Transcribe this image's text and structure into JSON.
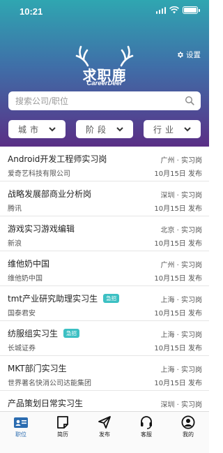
{
  "status": {
    "time": "10:21"
  },
  "logo": {
    "name_cn": "求职鹿",
    "name_en": "CareerDeer"
  },
  "settings": {
    "label": "设置"
  },
  "search": {
    "placeholder": "搜索公司/职位"
  },
  "filters": [
    {
      "label": "城市"
    },
    {
      "label": "阶段"
    },
    {
      "label": "行业"
    }
  ],
  "jobs": [
    {
      "title": "Android开发工程师实习岗",
      "location": "广州 · 实习岗",
      "company": "爱奇艺科技有限公司",
      "date": "10月15日 发布",
      "urgent": ""
    },
    {
      "title": "战略发展部商业分析岗",
      "location": "深圳 · 实习岗",
      "company": "腾讯",
      "date": "10月15日 发布",
      "urgent": ""
    },
    {
      "title": "游戏实习游戏编辑",
      "location": "北京 · 实习岗",
      "company": "新浪",
      "date": "10月15日 发布",
      "urgent": ""
    },
    {
      "title": "维他奶中国",
      "location": "广州 · 实习岗",
      "company": "维他奶中国",
      "date": "10月15日 发布",
      "urgent": ""
    },
    {
      "title": "tmt产业研究助理实习生",
      "location": "上海 · 实习岗",
      "company": "国泰君安",
      "date": "10月15日 发布",
      "urgent": "急招"
    },
    {
      "title": "纺服组实习生",
      "location": "上海 · 实习岗",
      "company": "长城证券",
      "date": "10月15日 发布",
      "urgent": "急招"
    },
    {
      "title": "MKT部门实习生",
      "location": "上海 · 实习岗",
      "company": "世界著名快消公司达能集团",
      "date": "10月15日 发布",
      "urgent": ""
    },
    {
      "title": "产品策划日常实习生",
      "location": "深圳 · 实习岗",
      "company": "",
      "date": "",
      "urgent": ""
    }
  ],
  "tabbar": [
    {
      "label": "职位",
      "icon": "job-card-icon",
      "active": true
    },
    {
      "label": "简历",
      "icon": "resume-icon",
      "active": false
    },
    {
      "label": "发布",
      "icon": "send-icon",
      "active": false
    },
    {
      "label": "客服",
      "icon": "headset-icon",
      "active": false
    },
    {
      "label": "我的",
      "icon": "profile-icon",
      "active": false
    }
  ],
  "colors": {
    "header_top": "#2fa6b1",
    "header_bottom": "#5a2f86",
    "accent": "#2b6cb0",
    "urgent_badge": "#3cc0c3"
  }
}
